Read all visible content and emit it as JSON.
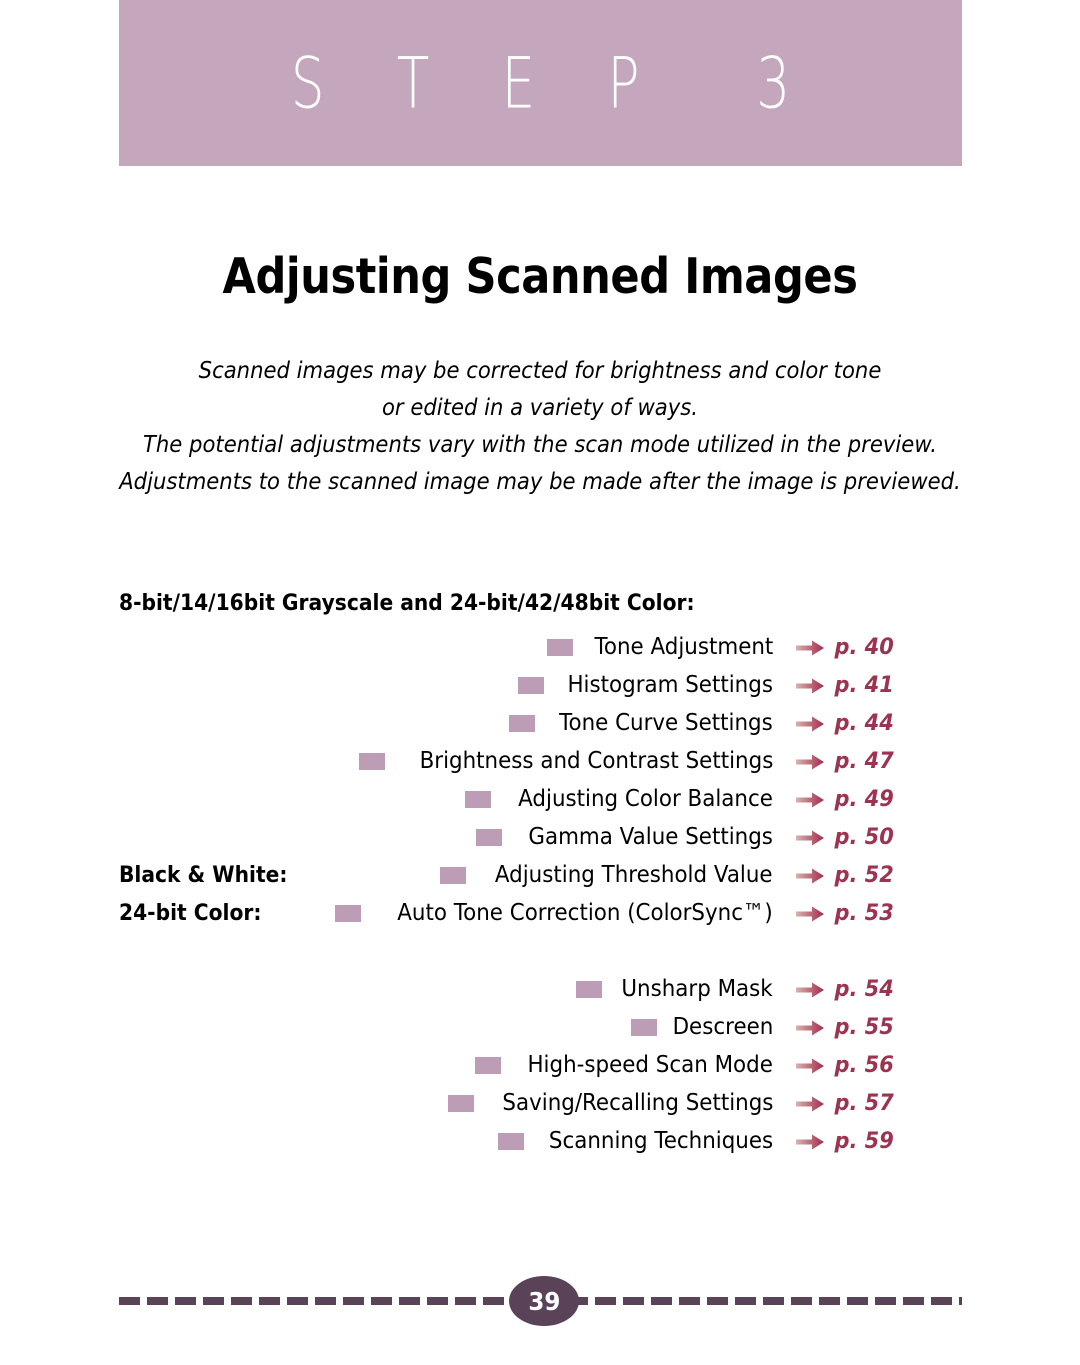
{
  "banner": {
    "step_label": "S T E P  3",
    "background_color": "#c4a7bd"
  },
  "title": "Adjusting Scanned Images",
  "subtitle": {
    "lines": [
      "Scanned images may be corrected for brightness and color tone",
      "or edited in a variety of ways.",
      "The potential adjustments vary with the scan mode utilized in the preview.",
      "Adjustments to the scanned image may be made after the image is previewed."
    ]
  },
  "contents": {
    "group_heading": "8-bit/14/16bit Grayscale and 24-bit/42/48bit Color:",
    "bullet_color": "#bd9cb5",
    "page_ref_color": "#9c3350",
    "rows": [
      {
        "side_label": "",
        "label": "Tone Adjustment",
        "page": "p. 40"
      },
      {
        "side_label": "",
        "label": "Histogram Settings",
        "page": "p. 41"
      },
      {
        "side_label": "",
        "label": "Tone Curve Settings",
        "page": "p. 44"
      },
      {
        "side_label": "",
        "label": "Brightness and Contrast Settings",
        "page": "p. 47"
      },
      {
        "side_label": "",
        "label": "Adjusting Color Balance",
        "page": "p. 49"
      },
      {
        "side_label": "",
        "label": "Gamma Value Settings",
        "page": "p. 50"
      },
      {
        "side_label": "Black & White:",
        "label": "Adjusting Threshold Value",
        "page": "p. 52"
      },
      {
        "side_label": "24-bit Color:",
        "label": "Auto Tone Correction (ColorSync™)",
        "page": "p. 53"
      },
      {
        "side_label": "",
        "label": "",
        "page": ""
      },
      {
        "side_label": "",
        "label": "Unsharp Mask",
        "page": "p. 54"
      },
      {
        "side_label": "",
        "label": "Descreen",
        "page": "p. 55"
      },
      {
        "side_label": "",
        "label": "High-speed Scan Mode",
        "page": "p. 56"
      },
      {
        "side_label": "",
        "label": "Saving/Recalling Settings",
        "page": "p. 57"
      },
      {
        "side_label": "",
        "label": "Scanning Techniques",
        "page": "p. 59"
      }
    ]
  },
  "footer": {
    "page_number": "39",
    "rule_color": "#5a4359"
  }
}
